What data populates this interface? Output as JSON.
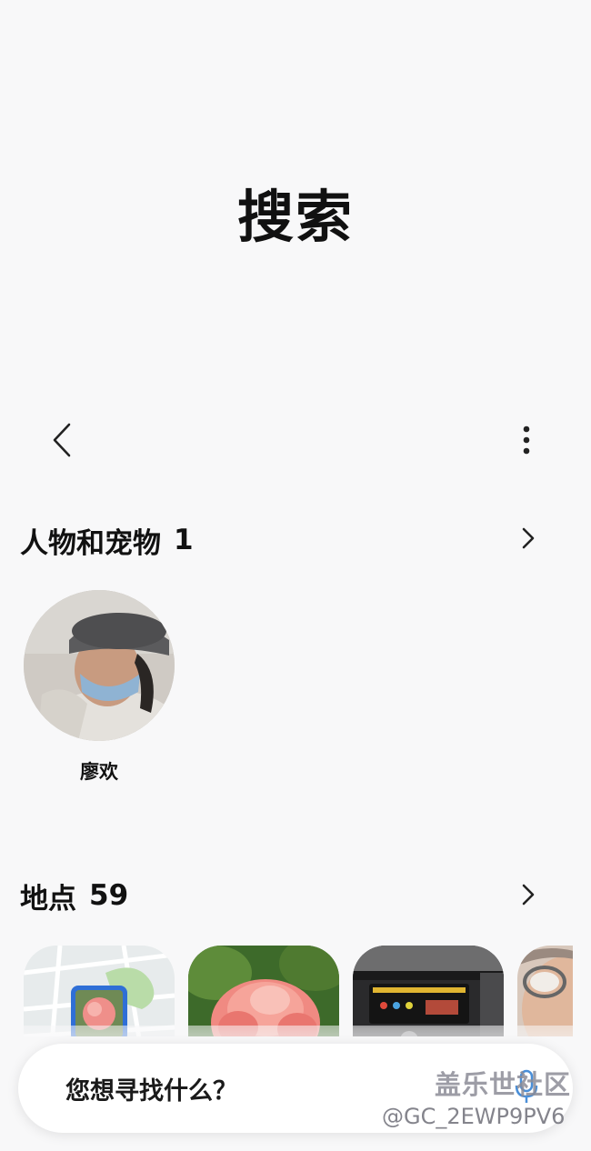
{
  "header": {
    "title": "搜索"
  },
  "toolbar": {
    "back_icon": "chevron-left-icon",
    "more_icon": "more-vertical-icon"
  },
  "people_section": {
    "label": "人物和宠物",
    "count": "1",
    "arrow_icon": "chevron-right-icon",
    "people": [
      {
        "name": "廖欢"
      }
    ]
  },
  "places_section": {
    "label": "地点",
    "count": "59",
    "arrow_icon": "chevron-right-icon",
    "thumbnails": [
      {
        "subject": "map with rose photo marker"
      },
      {
        "subject": "pink rose"
      },
      {
        "subject": "car engine bay"
      },
      {
        "subject": "man with glasses"
      }
    ]
  },
  "search": {
    "placeholder": "您想寻找什么？",
    "mic_icon": "microphone-icon"
  },
  "watermark": {
    "line1": "盖乐世社区",
    "line2": "@GC_2EWP9PV6"
  }
}
